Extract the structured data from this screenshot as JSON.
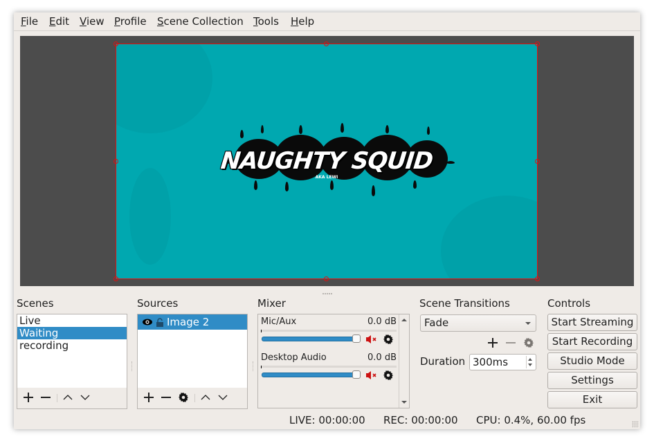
{
  "menu": [
    {
      "accel": "F",
      "rest": "ile"
    },
    {
      "accel": "E",
      "rest": "dit"
    },
    {
      "accel": "V",
      "rest": "iew"
    },
    {
      "accel": "P",
      "rest": "rofile"
    },
    {
      "accel": "S",
      "rest": "cene Collection"
    },
    {
      "accel": "T",
      "rest": "ools"
    },
    {
      "accel": "H",
      "rest": "elp"
    }
  ],
  "preview": {
    "logo_title": "NAUGHTY SQUID",
    "logo_subtitle": "AKA LEWI",
    "canvas_color": "#00a8b0",
    "selection_color": "#e01010"
  },
  "scenes": {
    "title": "Scenes",
    "items": [
      "Live",
      "Waiting",
      "recording"
    ],
    "selected": "Waiting"
  },
  "sources": {
    "title": "Sources",
    "items": [
      {
        "name": "Image 2",
        "visible": true,
        "locked": false
      }
    ]
  },
  "mixer": {
    "title": "Mixer",
    "channels": [
      {
        "name": "Mic/Aux",
        "level": "0.0 dB",
        "volume_percent": 100,
        "muted": true
      },
      {
        "name": "Desktop Audio",
        "level": "0.0 dB",
        "volume_percent": 100,
        "muted": true
      }
    ]
  },
  "transitions": {
    "title": "Scene Transitions",
    "selected": "Fade",
    "duration_label": "Duration",
    "duration_value": "300ms"
  },
  "controls": {
    "title": "Controls",
    "start_streaming": "Start Streaming",
    "start_recording": "Start Recording",
    "studio_mode": "Studio Mode",
    "settings": "Settings",
    "exit": "Exit"
  },
  "status": {
    "live": "LIVE: 00:00:00",
    "rec": "REC: 00:00:00",
    "cpu": "CPU: 0.4%, 60.00 fps"
  },
  "colors": {
    "selection": "#308cc6",
    "mute_red": "#cc1111"
  }
}
